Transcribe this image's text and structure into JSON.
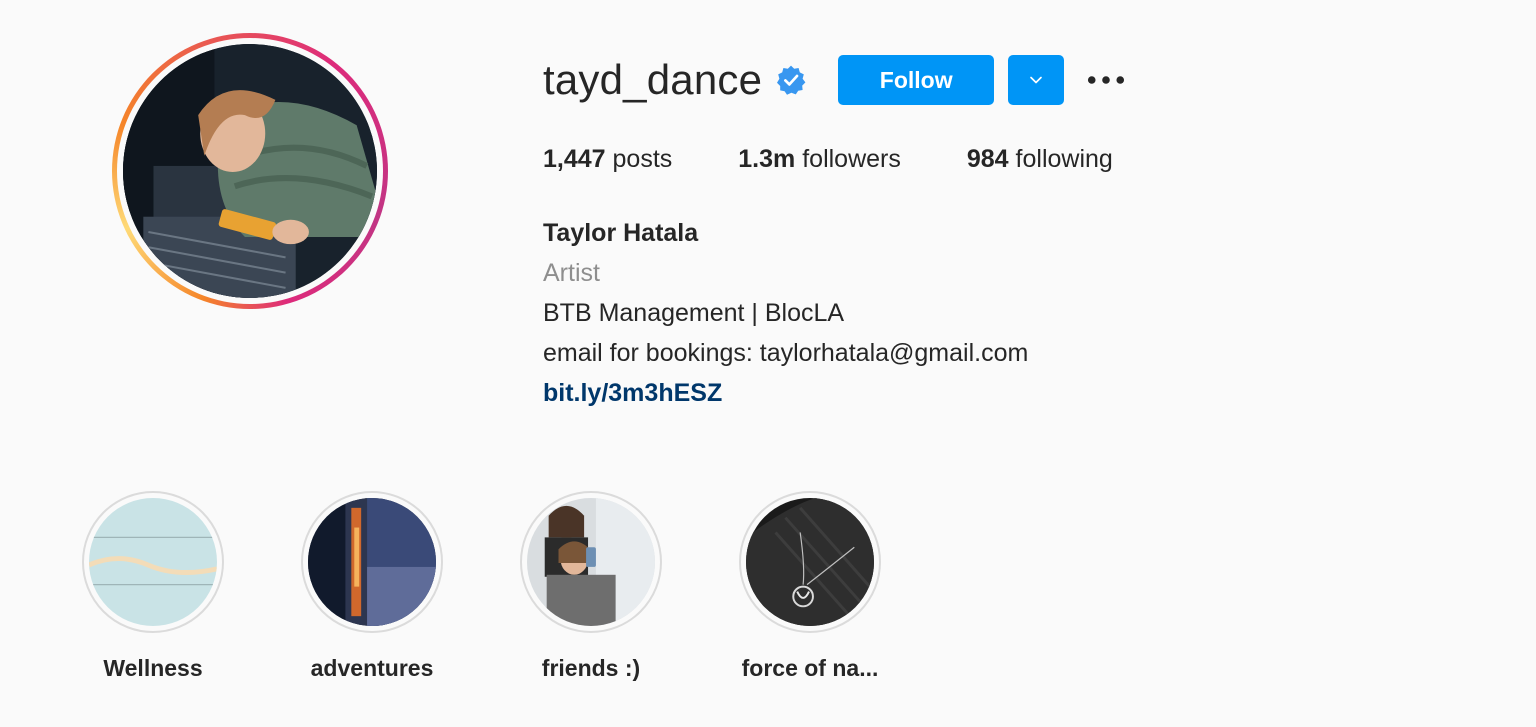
{
  "profile": {
    "username": "tayd_dance",
    "verified": true,
    "follow_label": "Follow",
    "stats": {
      "posts_count": "1,447",
      "posts_label": "posts",
      "followers_count": "1.3m",
      "followers_label": "followers",
      "following_count": "984",
      "following_label": "following"
    },
    "bio": {
      "name": "Taylor Hatala",
      "category": "Artist",
      "line1": "BTB Management | BlocLA",
      "line2": "email for bookings: taylorhatala@gmail.com",
      "link": "bit.ly/3m3hESZ"
    }
  },
  "highlights": [
    {
      "label": "Wellness"
    },
    {
      "label": "adventures"
    },
    {
      "label": "friends :)"
    },
    {
      "label": "force of na..."
    }
  ],
  "colors": {
    "accent": "#0095f6",
    "link": "#00376b",
    "muted": "#8e8e8e",
    "text": "#262626",
    "background": "#fafafa"
  },
  "icons": {
    "verified": "verified-badge-icon",
    "dropdown": "chevron-down-icon",
    "more": "more-options-icon"
  }
}
